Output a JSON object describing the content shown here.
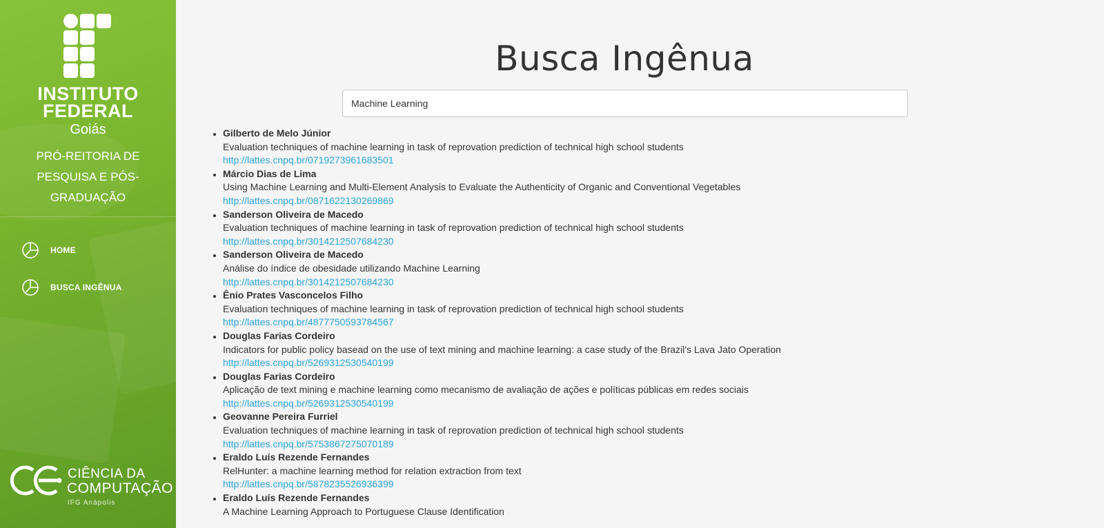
{
  "sidebar": {
    "institution_line1": "INSTITUTO",
    "institution_line2": "FEDERAL",
    "institution_state": "Goiás",
    "department": "PRÓ-REITORIA DE PESQUISA E PÓS-GRADUAÇÃO",
    "nav": [
      {
        "label": "HOME",
        "icon": "pie-chart-icon"
      },
      {
        "label": "BUSCA INGÊNUA",
        "icon": "pie-chart-icon"
      }
    ],
    "footer_logo": {
      "line1": "CIÊNCIA DA",
      "line2": "COMPUTAÇÃO",
      "line3": "IFG Anápolis"
    }
  },
  "main": {
    "title": "Busca Ingênua",
    "search": {
      "value": "Machine Learning"
    },
    "results": [
      {
        "name": "Gilberto de Melo Júnior",
        "title": "Evaluation techniques of machine learning in task of reprovation prediction of technical high school students",
        "link": "http://lattes.cnpq.br/0719273961683501"
      },
      {
        "name": "Márcio Dias de Lima",
        "title": "Using Machine Learning and Multi-Element Analysis to Evaluate the Authenticity of Organic and Conventional Vegetables",
        "link": "http://lattes.cnpq.br/0871622130269869"
      },
      {
        "name": "Sanderson Oliveira de Macedo",
        "title": "Evaluation techniques of machine learning in task of reprovation prediction of technical high school students",
        "link": "http://lattes.cnpq.br/3014212507684230"
      },
      {
        "name": "Sanderson Oliveira de Macedo",
        "title": "Análise do índice de obesidade utilizando Machine Learning",
        "link": "http://lattes.cnpq.br/3014212507684230"
      },
      {
        "name": "Ênio Prates Vasconcelos Filho",
        "title": "Evaluation techniques of machine learning in task of reprovation prediction of technical high school students",
        "link": "http://lattes.cnpq.br/4877750593784567"
      },
      {
        "name": "Douglas Farias Cordeiro",
        "title": "Indicators for public policy basead on the use of text mining and machine learning: a case study of the Brazil's Lava Jato Operation",
        "link": "http://lattes.cnpq.br/5269312530540199"
      },
      {
        "name": "Douglas Farias Cordeiro",
        "title": "Aplicação de text mining e machine learning como mecanismo de avaliação de ações e políticas públicas em redes sociais",
        "link": "http://lattes.cnpq.br/5269312530540199"
      },
      {
        "name": "Geovanne Pereira Furriel",
        "title": "Evaluation techniques of machine learning in task of reprovation prediction of technical high school students",
        "link": "http://lattes.cnpq.br/5753867275070189"
      },
      {
        "name": "Eraldo Luís Rezende Fernandes",
        "title": "RelHunter: a machine learning method for relation extraction from text",
        "link": "http://lattes.cnpq.br/5878235526936399"
      },
      {
        "name": "Eraldo Luís Rezende Fernandes",
        "title": "A Machine Learning Approach to Portuguese Clause Identification",
        "link": ""
      }
    ]
  }
}
